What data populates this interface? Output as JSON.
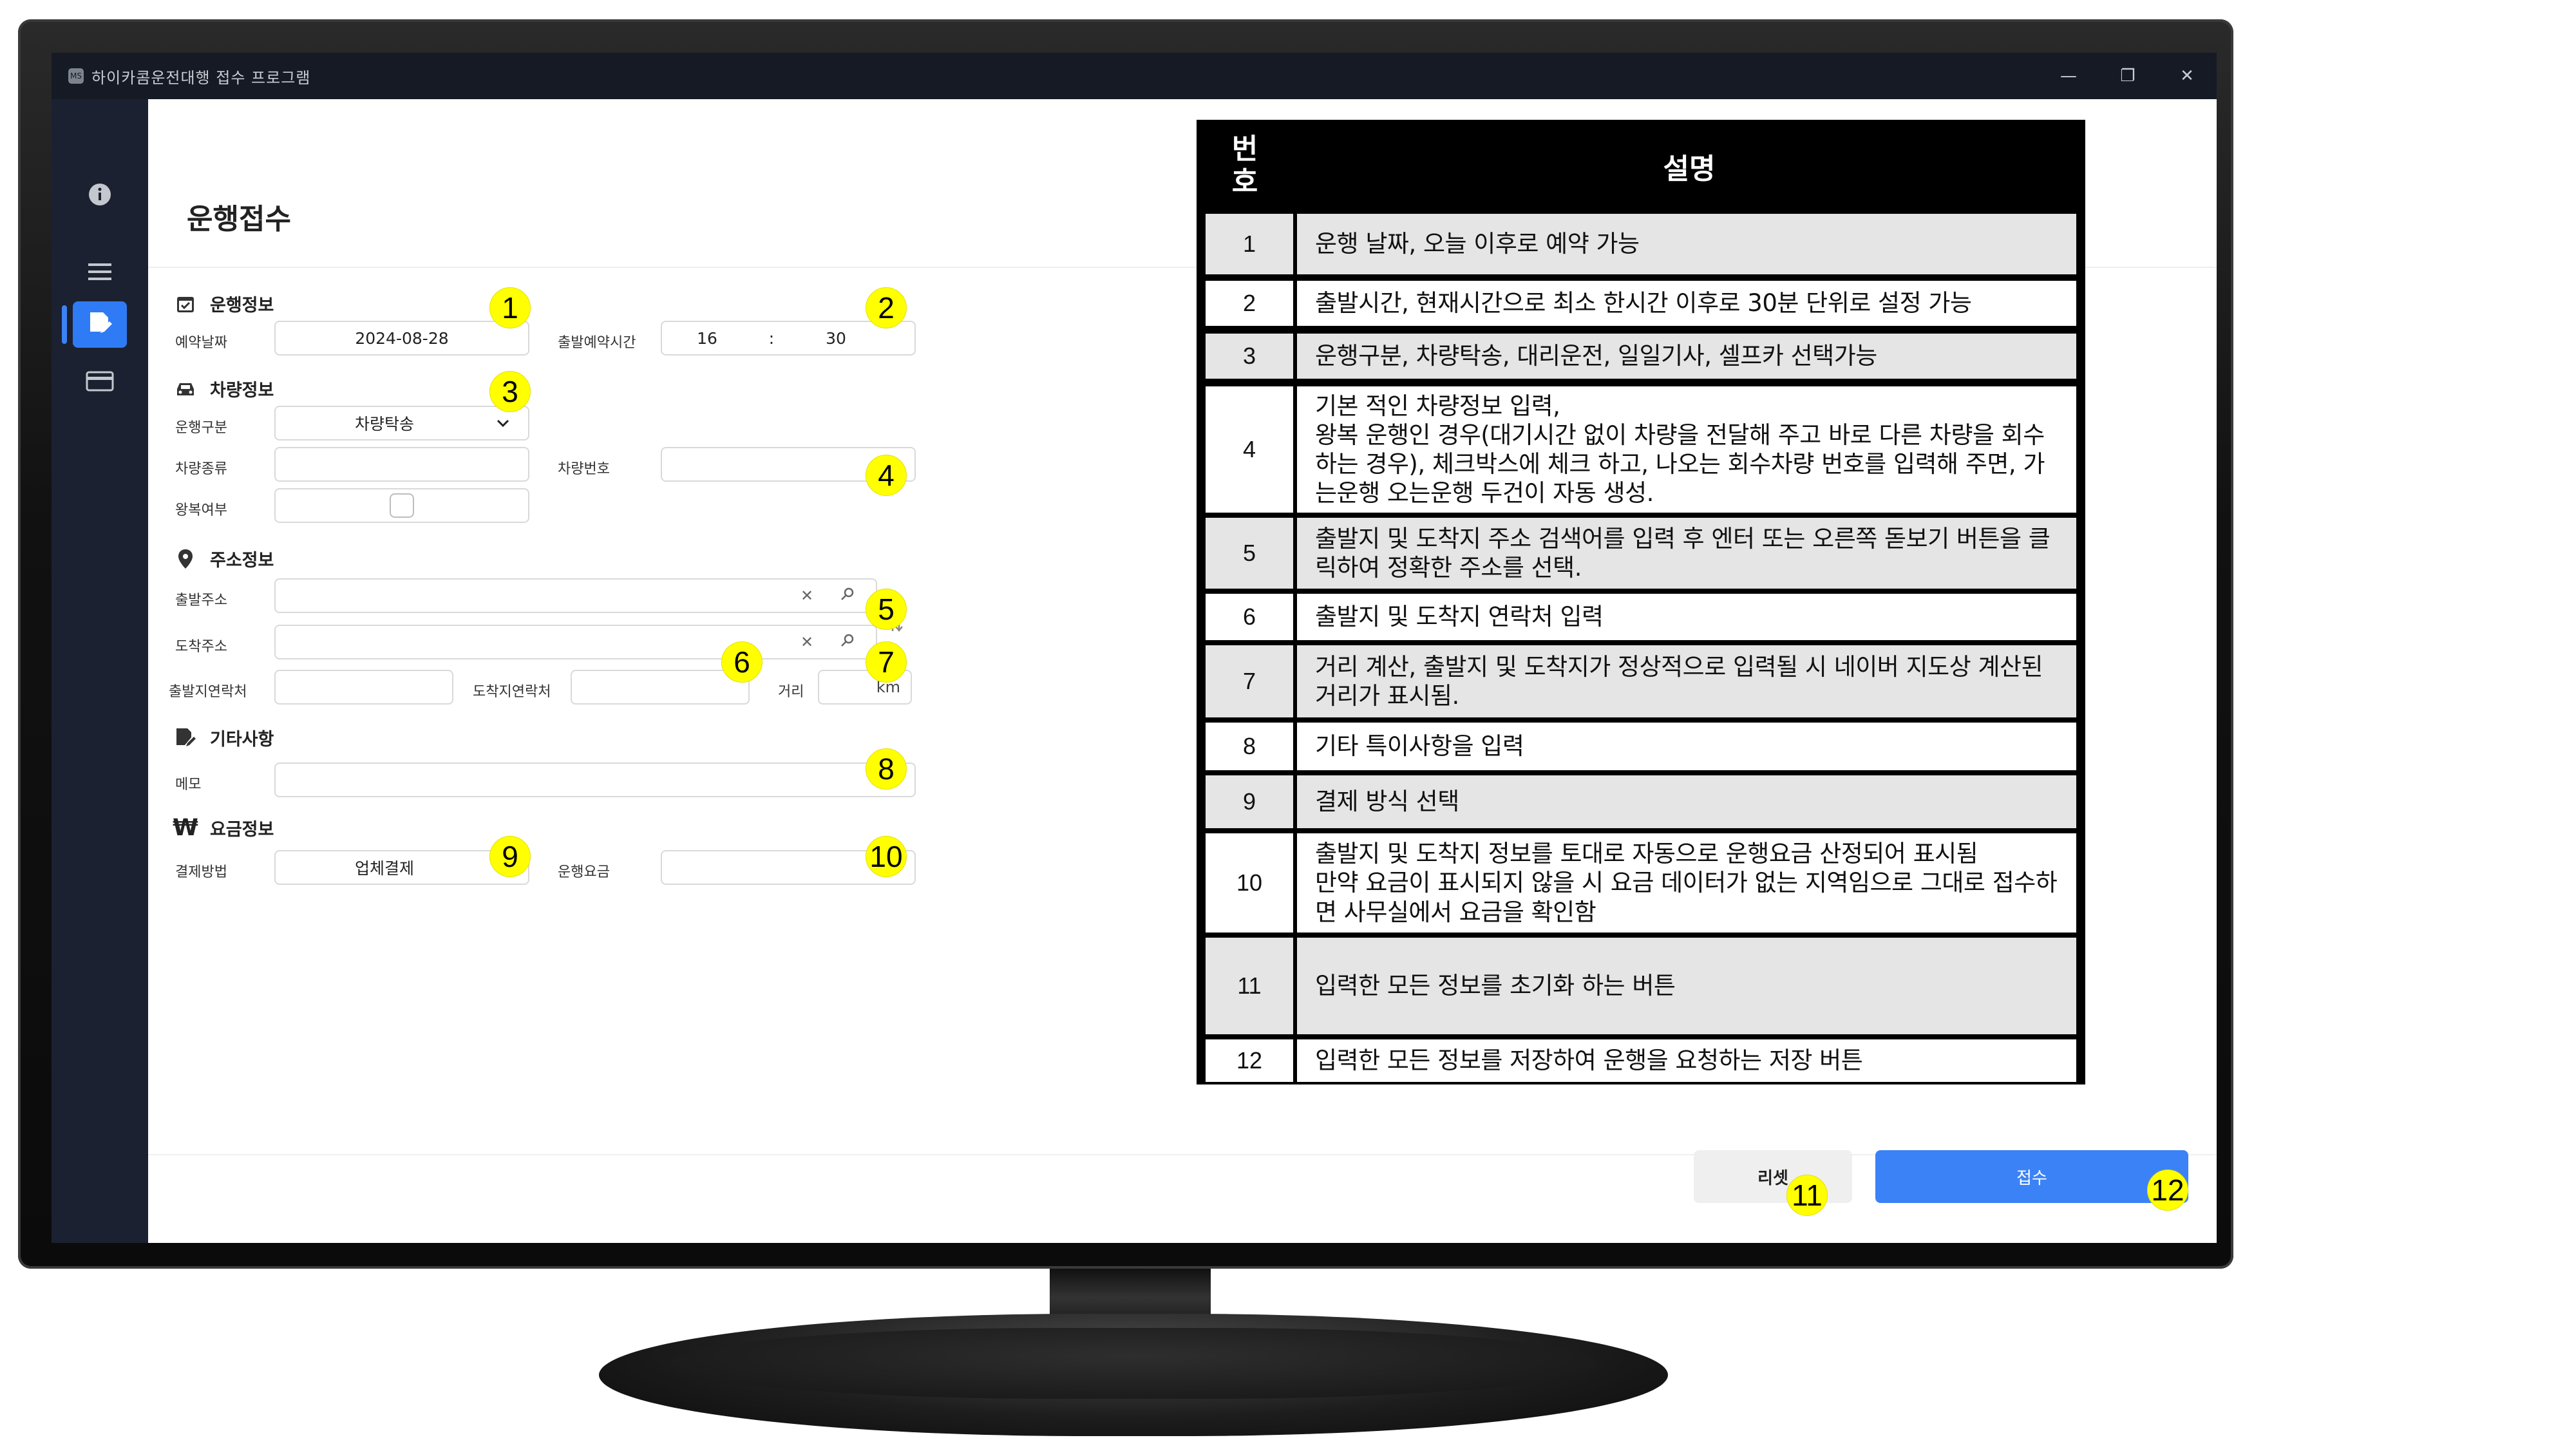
{
  "window": {
    "title": "하이카콤운전대행 접수 프로그램",
    "app_icon": "MS",
    "controls": {
      "minimize": "—",
      "restore": "❐",
      "close": "✕"
    }
  },
  "sidebar": {
    "items": [
      {
        "icon": "info-icon"
      },
      {
        "icon": "menu-icon"
      },
      {
        "icon": "edit-document-icon",
        "active": true
      },
      {
        "icon": "credit-card-icon"
      }
    ]
  },
  "page": {
    "title": "운행접수"
  },
  "sections": {
    "drive_info": "운행정보",
    "vehicle_info": "차량정보",
    "address_info": "주소정보",
    "etc_info": "기타사항",
    "fee_info": "요금정보"
  },
  "form": {
    "reserve_date_label": "예약날짜",
    "reserve_date_value": "2024-08-28",
    "departure_time_label": "출발예약시간",
    "departure_hour": "16",
    "time_separator": ":",
    "departure_minute": "30",
    "drive_type_label": "운행구분",
    "drive_type_value": "차량탁송",
    "vehicle_type_label": "차량종류",
    "vehicle_type_value": "",
    "vehicle_number_label": "차량번호",
    "vehicle_number_value": "",
    "round_trip_label": "왕복여부",
    "round_trip_checked": false,
    "origin_label": "출발주소",
    "origin_value": "",
    "destination_label": "도착주소",
    "destination_value": "",
    "origin_contact_label": "출발지연락처",
    "origin_contact_value": "",
    "dest_contact_label": "도착지연락처",
    "dest_contact_value": "",
    "distance_label": "거리",
    "distance_unit": "km",
    "memo_label": "메모",
    "memo_value": "",
    "payment_label": "결제방법",
    "payment_value": "업체결제",
    "fee_label": "운행요금",
    "fee_value": ""
  },
  "buttons": {
    "reset": "리셋",
    "submit": "접수"
  },
  "badges": [
    "1",
    "2",
    "3",
    "4",
    "5",
    "6",
    "7",
    "8",
    "9",
    "10",
    "11",
    "12"
  ],
  "table": {
    "header_num_line1": "번",
    "header_num_line2": "호",
    "header_desc": "설명",
    "rows": [
      {
        "num": "1",
        "desc": "운행 날짜, 오늘 이후로 예약 가능"
      },
      {
        "num": "2",
        "desc": "출발시간, 현재시간으로 최소 한시간 이후로 30분 단위로 설정 가능"
      },
      {
        "num": "3",
        "desc": "운행구분, 차량탁송, 대리운전, 일일기사, 셀프카 선택가능"
      },
      {
        "num": "4",
        "desc": "기본 적인 차량정보 입력,\n왕복 운행인 경우(대기시간 없이 차량을 전달해 주고 바로 다른 차량을 회수하는 경우), 체크박스에 체크 하고, 나오는 회수차량 번호를 입력해 주면, 가는운행 오는운행 두건이 자동 생성."
      },
      {
        "num": "5",
        "desc": "출발지 및 도착지 주소 검색어를 입력 후 엔터 또는 오른쪽 돋보기 버튼을 클릭하여 정확한 주소를 선택."
      },
      {
        "num": "6",
        "desc": "출발지 및 도착지 연락처 입력"
      },
      {
        "num": "7",
        "desc": "거리 계산, 출발지 및 도착지가 정상적으로 입력될 시 네이버 지도상 계산된 거리가 표시됨."
      },
      {
        "num": "8",
        "desc": "기타 특이사항을 입력"
      },
      {
        "num": "9",
        "desc": "결제 방식 선택"
      },
      {
        "num": "10",
        "desc": "출발지 및 도착지 정보를 토대로 자동으로 운행요금 산정되어 표시됨\n만약 요금이 표시되지 않을 시 요금 데이터가 없는 지역임으로 그대로 접수하면 사무실에서 요금을 확인함"
      },
      {
        "num": "11",
        "desc": "입력한 모든 정보를 초기화 하는 버튼"
      },
      {
        "num": "12",
        "desc": "입력한 모든 정보를 저장하여 운행을 요청하는 저장 버튼"
      }
    ]
  }
}
